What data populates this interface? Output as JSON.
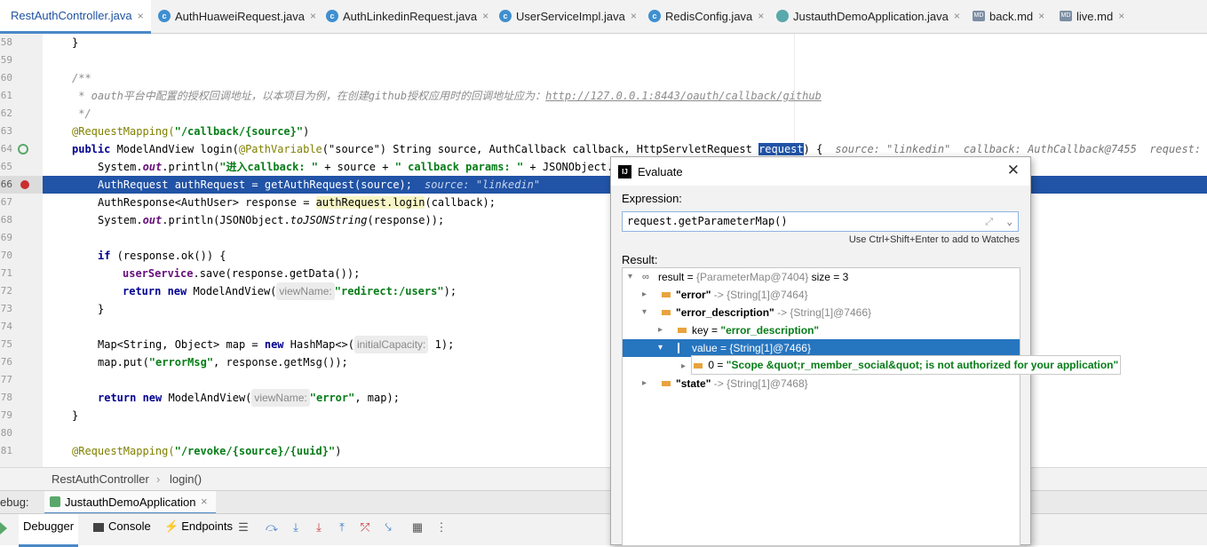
{
  "tabs": [
    {
      "label": "RestAuthController.java",
      "icon": "class-icon"
    },
    {
      "label": "AuthHuaweiRequest.java",
      "icon": "class-icon"
    },
    {
      "label": "AuthLinkedinRequest.java",
      "icon": "class-icon"
    },
    {
      "label": "UserServiceImpl.java",
      "icon": "class-icon"
    },
    {
      "label": "RedisConfig.java",
      "icon": "class-icon"
    },
    {
      "label": "JustauthDemoApplication.java",
      "icon": "spring-class-icon"
    },
    {
      "label": "back.md",
      "icon": "markdown-icon"
    },
    {
      "label": "live.md",
      "icon": "markdown-icon"
    }
  ],
  "tab_close_glyph": "×",
  "md_badge": "MD",
  "line_numbers": [
    "58",
    "59",
    "60",
    "61",
    "62",
    "63",
    "64",
    "65",
    "66",
    "67",
    "68",
    "69",
    "70",
    "71",
    "72",
    "73",
    "74",
    "75",
    "76",
    "77",
    "78",
    "79",
    "80",
    "81"
  ],
  "code": {
    "l58": "}",
    "l60": "/**",
    "l61a": " * oauth平台中配置的授权回调地址，以本项目为例，在创建github授权应用时的回调地址应为：",
    "l61b": "http://127.0.0.1:8443/oauth/callback/github",
    "l62": " */",
    "l63a": "@RequestMapping(",
    "l63b": "\"/callback/{source}\"",
    "l63c": ")",
    "l64a": "public",
    "l64b": " ModelAndView login(",
    "l64c": "@PathVariable",
    "l64d": "(\"source\")",
    "l64e": " String source, AuthCallback callback, HttpServletRequest ",
    "l64f": "request",
    "l64g": ") {",
    "l64h": "source: \"linkedin\"  callback: AuthCallback@7455  request: Reques",
    "l65a": "System.",
    "l65b": "out",
    "l65c": ".println(",
    "l65d": "\"进入callback: \"",
    "l65e": " + source + ",
    "l65f": "\" callback params: \"",
    "l65g": " + JSONObject.to",
    "l66": "AuthRequest authRequest = getAuthRequest(source);",
    "l66h": "source: \"linkedin\"",
    "l67a": "AuthResponse<AuthUser> response = ",
    "l67b": "authRequest.login",
    "l67c": "(callback);",
    "l68a": "System.",
    "l68b": "out",
    "l68c": ".println(JSONObject.",
    "l68d": "toJSONString",
    "l68e": "(response));",
    "l70a": "if",
    "l70b": " (response.ok()) {",
    "l71a": "userService",
    "l71b": ".save(response.getData());",
    "l72a": "return new",
    "l72b": " ModelAndView(",
    "l72c": "viewName:",
    "l72d": "\"redirect:/users\"",
    "l72e": ");",
    "l73": "}",
    "l75a": "Map<String, Object> map = ",
    "l75b": "new",
    "l75c": " HashMap<>(",
    "l75d": "initialCapacity:",
    "l75e": " 1);",
    "l76a": "map.put(",
    "l76b": "\"errorMsg\"",
    "l76c": ", response.getMsg());",
    "l78a": "return new",
    "l78b": " ModelAndView(",
    "l78c": "viewName:",
    "l78d": "\"error\"",
    "l78e": ", map);",
    "l79": "}",
    "l81a": "@RequestMapping(",
    "l81b": "\"/revoke/{source}/{uuid}\"",
    "l81c": ")"
  },
  "breadcrumb": {
    "class": "RestAuthController",
    "sep": "›",
    "method": "login()"
  },
  "debug": {
    "label": "ebug:",
    "session": "JustauthDemoApplication",
    "close": "×"
  },
  "debug_tabs": {
    "debugger": "Debugger",
    "console": "Console",
    "endpoints": "Endpoints"
  },
  "dialog": {
    "title": "Evaluate",
    "logo": "IJ",
    "close": "✕",
    "expression_label": "Expression:",
    "expression": "request.getParameterMap()",
    "hint": "Use Ctrl+Shift+Enter to add to Watches",
    "result_label": "Result:",
    "result": {
      "name": "result",
      "eq": " = ",
      "ref": "{ParameterMap@7404}",
      "size": "  size = 3",
      "entries": [
        {
          "key": "\"error\"",
          "arrow": " -> ",
          "ref": "{String[1]@7464}"
        },
        {
          "key": "\"error_description\"",
          "arrow": " -> ",
          "ref": "{String[1]@7466}"
        },
        {
          "key": "\"state\"",
          "arrow": " -> ",
          "ref": "{String[1]@7468}"
        }
      ],
      "key_row": {
        "name": "key",
        "eq": " = ",
        "value": "\"error_description\""
      },
      "value_row": {
        "name": "value",
        "eq": " = ",
        "value": "{String[1]@7466}"
      },
      "item_row": {
        "index": "0",
        "eq": " = ",
        "value": "\"Scope &quot;r_member_social&quot; is not authorized for your application\""
      }
    }
  },
  "colors": {
    "selection": "#2153a6",
    "tree_selection": "#2675bf",
    "string": "#067d17",
    "keyword": "#00008f"
  }
}
